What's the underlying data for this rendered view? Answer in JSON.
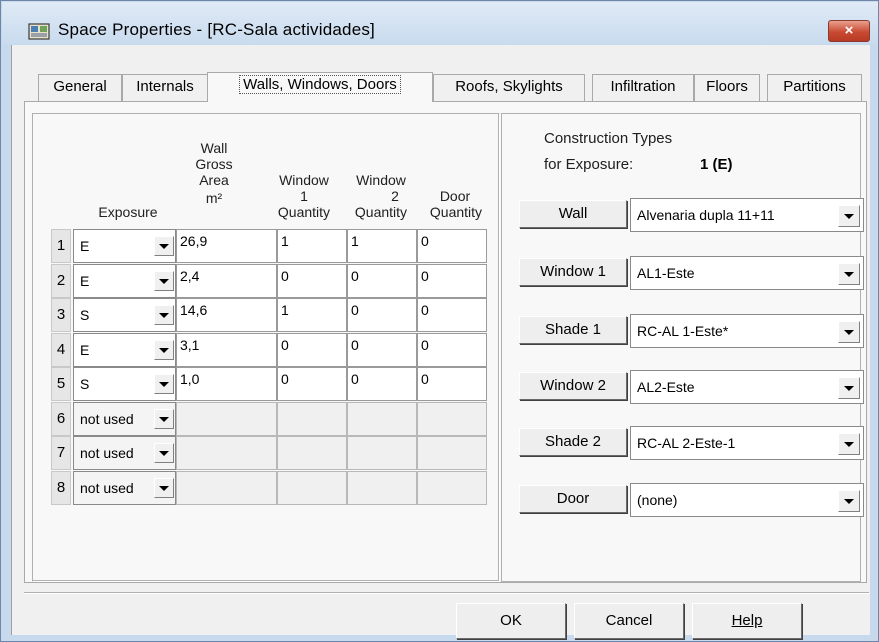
{
  "window": {
    "title": "Space Properties - [RC-Sala actividades]",
    "close_glyph": "×",
    "accent_close": "#c94a33"
  },
  "tabs": [
    {
      "label": "General",
      "active": false
    },
    {
      "label": "Internals",
      "active": false
    },
    {
      "label": "Walls, Windows, Doors",
      "active": true
    },
    {
      "label": "Roofs, Skylights",
      "active": false
    },
    {
      "label": "Infiltration",
      "active": false
    },
    {
      "label": "Floors",
      "active": false
    },
    {
      "label": "Partitions",
      "active": false
    }
  ],
  "walls_table": {
    "headers": {
      "exposure": "Exposure",
      "area_line1": "Wall",
      "area_line2": "Gross",
      "area_line3": "Area",
      "area_line4": "m²",
      "win1_line1": "Window",
      "win1_line2": "1",
      "win1_line3": "Quantity",
      "win2_line1": "Window",
      "win2_line2": "2",
      "win2_line3": "Quantity",
      "door_line1": "Door",
      "door_line2": "Quantity"
    },
    "rows": [
      {
        "n": "1",
        "exposure": "E",
        "area": "26,9",
        "win1": "1",
        "win2": "1",
        "door": "0"
      },
      {
        "n": "2",
        "exposure": "E",
        "area": "2,4",
        "win1": "0",
        "win2": "0",
        "door": "0"
      },
      {
        "n": "3",
        "exposure": "S",
        "area": "14,6",
        "win1": "1",
        "win2": "0",
        "door": "0"
      },
      {
        "n": "4",
        "exposure": "E",
        "area": "3,1",
        "win1": "0",
        "win2": "0",
        "door": "0"
      },
      {
        "n": "5",
        "exposure": "S",
        "area": "1,0",
        "win1": "0",
        "win2": "0",
        "door": "0"
      },
      {
        "n": "6",
        "exposure": "not used",
        "area": "",
        "win1": "",
        "win2": "",
        "door": ""
      },
      {
        "n": "7",
        "exposure": "not used",
        "area": "",
        "win1": "",
        "win2": "",
        "door": ""
      },
      {
        "n": "8",
        "exposure": "not used",
        "area": "",
        "win1": "",
        "win2": "",
        "door": ""
      }
    ]
  },
  "construction": {
    "heading_line1": "Construction Types",
    "heading_line2": "for Exposure:",
    "exposure_value": "1 (E)",
    "items": [
      {
        "button": "Wall",
        "value": "Alvenaria dupla 11+11"
      },
      {
        "button": "Window 1",
        "value": "AL1-Este"
      },
      {
        "button": "Shade 1",
        "value": "RC-AL 1-Este*"
      },
      {
        "button": "Window 2",
        "value": "AL2-Este"
      },
      {
        "button": "Shade 2",
        "value": "RC-AL 2-Este-1"
      },
      {
        "button": "Door",
        "value": "(none)"
      }
    ]
  },
  "footer": {
    "ok": "OK",
    "cancel": "Cancel",
    "help": "Help"
  }
}
